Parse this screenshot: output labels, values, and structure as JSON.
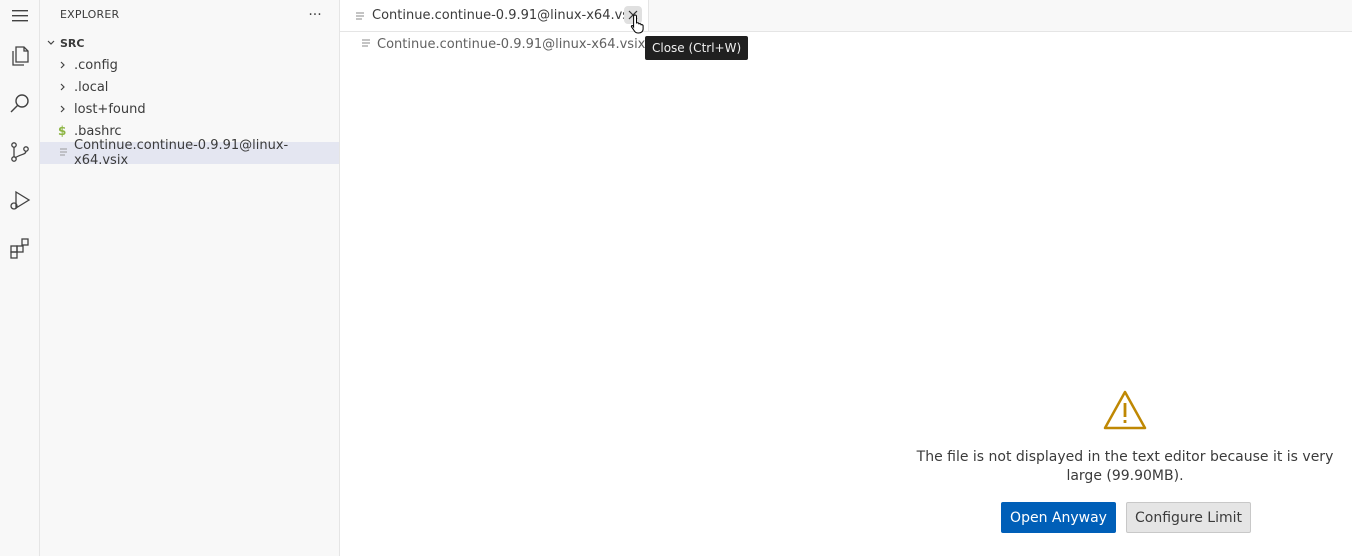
{
  "sidebar": {
    "title": "EXPLORER",
    "more_label": "···",
    "root": {
      "label": "SRC"
    },
    "items": [
      {
        "label": ".config",
        "kind": "folder"
      },
      {
        "label": ".local",
        "kind": "folder"
      },
      {
        "label": "lost+found",
        "kind": "folder"
      },
      {
        "label": ".bashrc",
        "kind": "file-shell"
      },
      {
        "label": "Continue.continue-0.9.91@linux-x64.vsix",
        "kind": "file",
        "selected": true
      }
    ]
  },
  "activity_bar": {
    "icons": [
      "menu-icon",
      "files-icon",
      "search-icon",
      "source-control-icon",
      "run-debug-icon",
      "extensions-icon"
    ]
  },
  "editor": {
    "tab": {
      "label": "Continue.continue-0.9.91@linux-x64.vsix"
    },
    "breadcrumb": "Continue.continue-0.9.91@linux-x64.vsix",
    "tooltip": "Close (Ctrl+W)",
    "warning": {
      "message": "The file is not displayed in the text editor because it is very large (99.90MB).",
      "open_anyway": "Open Anyway",
      "configure_limit": "Configure Limit"
    }
  },
  "colors": {
    "accent": "#005fb8",
    "selection": "#e4e6f1",
    "warning": "#bf8803",
    "shell": "#8db544"
  }
}
